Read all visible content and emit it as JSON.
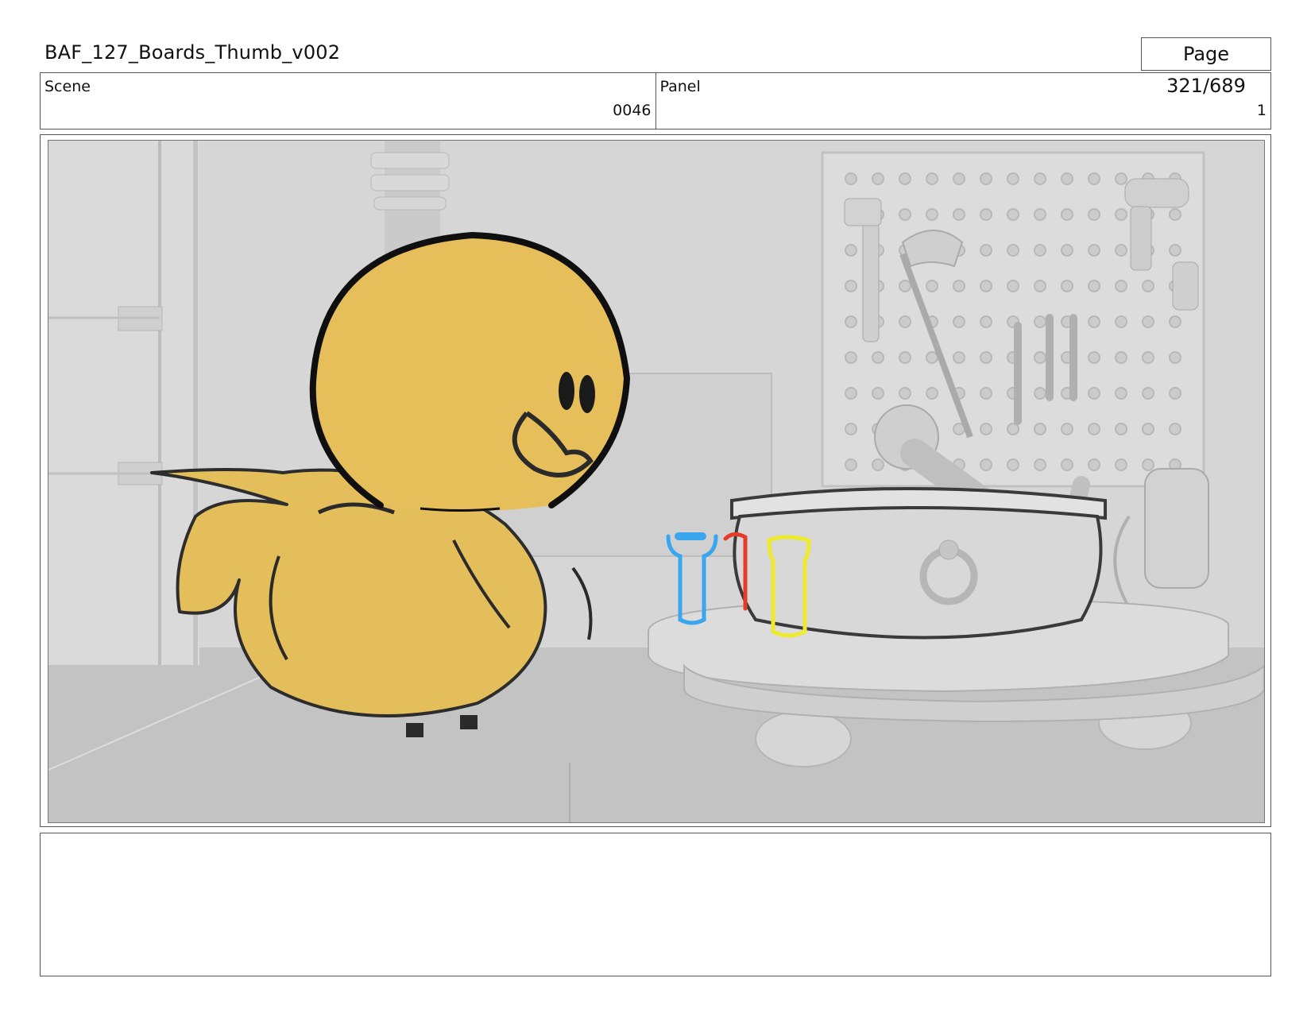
{
  "header": {
    "title": "BAF_127_Boards_Thumb_v002",
    "page": "Page 321/689"
  },
  "info": {
    "scene_label": "Scene",
    "scene_value": "0046",
    "panel_label": "Panel",
    "panel_value": "1"
  },
  "panel": {
    "duck_color": "#E6BE5A",
    "outline_color": "#1a1a1a",
    "background_tone": "#d4d4d4",
    "bottle_colors": [
      "#3aa6ee",
      "#e53b2a",
      "#eeea30"
    ]
  },
  "notes": {
    "text": ""
  }
}
